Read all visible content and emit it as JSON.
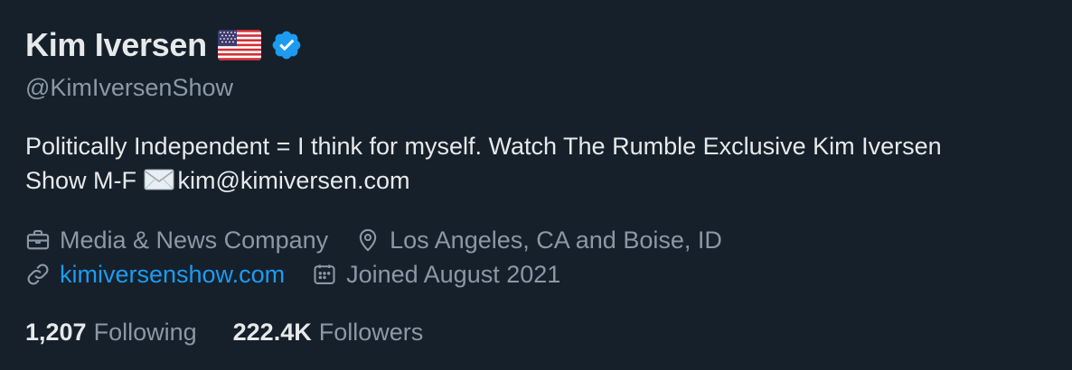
{
  "profile": {
    "display_name": "Kim Iversen",
    "handle": "@KimIversenShow",
    "bio_text": "Politically Independent = I think for myself. Watch The Rumble Exclusive Kim Iversen Show M-F ",
    "bio_email": "kim@kimiversen.com",
    "category": "Media & News Company",
    "location": "Los Angeles, CA and Boise, ID",
    "website": "kimiversenshow.com",
    "joined": "Joined August 2021"
  },
  "stats": {
    "following_count": "1,207",
    "following_label": "Following",
    "followers_count": "222.4K",
    "followers_label": "Followers"
  },
  "colors": {
    "background": "#15202b",
    "primary_text": "#e7e9ea",
    "secondary_text": "#8b98a5",
    "link": "#1d9bf0",
    "verified": "#1d9bf0"
  },
  "icons": {
    "flag": "us-flag-icon",
    "verified": "verified-badge-icon",
    "envelope": "envelope-icon",
    "category": "briefcase-icon",
    "location": "location-pin-icon",
    "website": "link-icon",
    "joined": "calendar-icon"
  }
}
